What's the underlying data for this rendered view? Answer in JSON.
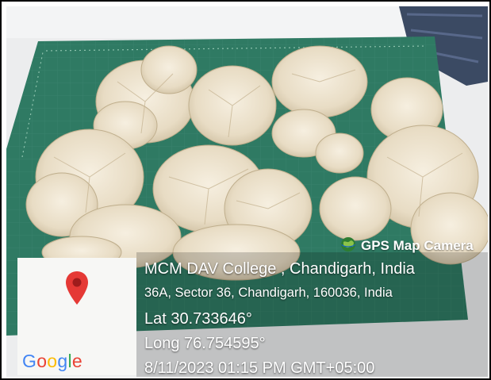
{
  "overlay": {
    "brand": "GPS Map Camera",
    "place": "MCM DAV College , Chandigarh, India",
    "address": "36A, Sector 36, Chandigarh, 160036, India",
    "latitude": "Lat 30.733646°",
    "longitude": "Long 76.754595°",
    "datetime": "8/11/2023 01:15 PM GMT+05:00"
  },
  "map": {
    "logo_letters": [
      "G",
      "o",
      "o",
      "g",
      "l",
      "e"
    ],
    "logo_colors": [
      "#4285F4",
      "#EA4335",
      "#FBBC05",
      "#4285F4",
      "#34A853",
      "#EA4335"
    ],
    "pin_color": "#E53935"
  },
  "icons": [
    "globe-icon",
    "map-pin-icon"
  ]
}
